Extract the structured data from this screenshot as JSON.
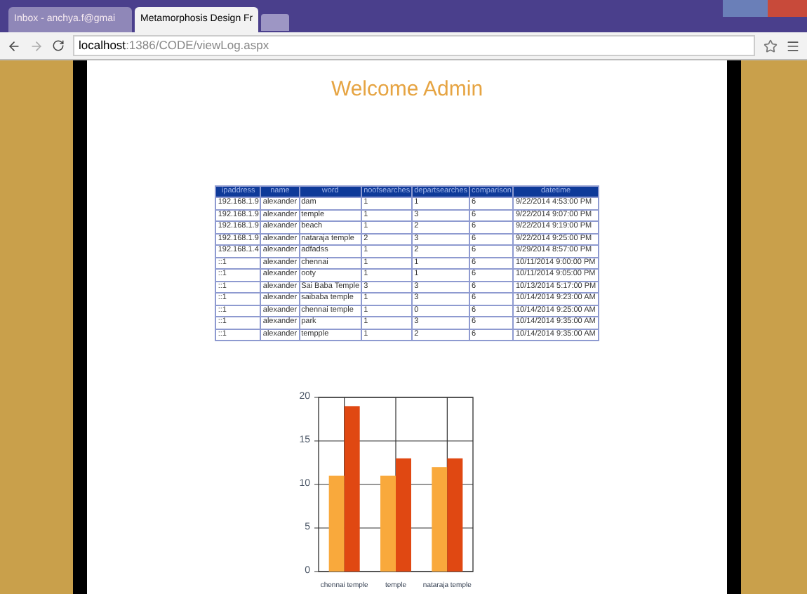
{
  "browser": {
    "tabs": [
      {
        "title": "Inbox - anchya.f@gmai",
        "selected": false
      },
      {
        "title": "Metamorphosis Design Fr",
        "selected": true
      }
    ],
    "url_host": "localhost",
    "url_path": ":1386/CODE/viewLog.aspx"
  },
  "heading": "Welcome Admin",
  "table": {
    "columns": [
      "ipaddress",
      "name",
      "word",
      "noofsearches",
      "departsearches",
      "comparison",
      "datetime"
    ],
    "rows": [
      [
        "192.168.1.9",
        "alexander",
        "dam",
        "1",
        "1",
        "6",
        "9/22/2014 4:53:00 PM"
      ],
      [
        "192.168.1.9",
        "alexander",
        "temple",
        "1",
        "3",
        "6",
        "9/22/2014 9:07:00 PM"
      ],
      [
        "192.168.1.9",
        "alexander",
        "beach",
        "1",
        "2",
        "6",
        "9/22/2014 9:19:00 PM"
      ],
      [
        "192.168.1.9",
        "alexander",
        "nataraja temple",
        "2",
        "3",
        "6",
        "9/22/2014 9:25:00 PM"
      ],
      [
        "192.168.1.4",
        "alexander",
        "adfadss",
        "1",
        "2",
        "6",
        "9/29/2014 8:57:00 PM"
      ],
      [
        "::1",
        "alexander",
        "chennai",
        "1",
        "1",
        "6",
        "10/11/2014 9:00:00 PM"
      ],
      [
        "::1",
        "alexander",
        "ooty",
        "1",
        "1",
        "6",
        "10/11/2014 9:05:00 PM"
      ],
      [
        "::1",
        "alexander",
        "Sai Baba Temple",
        "3",
        "3",
        "6",
        "10/13/2014 5:17:00 PM"
      ],
      [
        "::1",
        "alexander",
        "saibaba temple",
        "1",
        "3",
        "6",
        "10/14/2014 9:23:00 AM"
      ],
      [
        "::1",
        "alexander",
        "chennai temple",
        "1",
        "0",
        "6",
        "10/14/2014 9:25:00 AM"
      ],
      [
        "::1",
        "alexander",
        "park",
        "1",
        "3",
        "6",
        "10/14/2014 9:35:00 AM"
      ],
      [
        "::1",
        "alexander",
        "tempple",
        "1",
        "2",
        "6",
        "10/14/2014 9:35:00 AM"
      ]
    ]
  },
  "chart_data": {
    "type": "bar",
    "categories": [
      "chennai temple",
      "temple",
      "nataraja temple"
    ],
    "series": [
      {
        "color": "#f9a93c",
        "values": [
          11,
          11,
          12
        ]
      },
      {
        "color": "#e04812",
        "values": [
          19,
          13,
          13
        ]
      }
    ],
    "ylim": [
      0,
      20
    ],
    "yticks": [
      0,
      5,
      10,
      15,
      20
    ],
    "grid": true
  }
}
